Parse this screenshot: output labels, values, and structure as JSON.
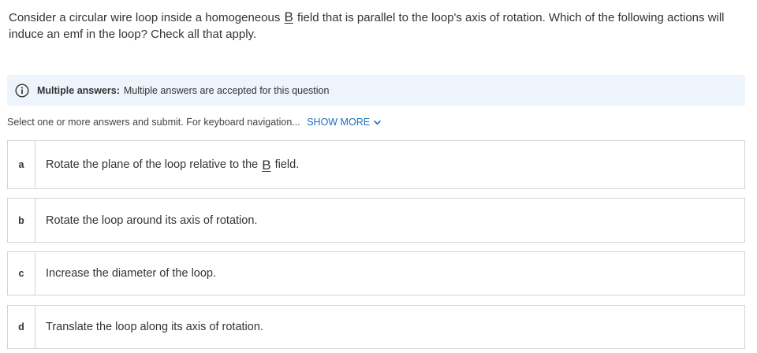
{
  "question": {
    "text_before": "Consider a circular wire loop inside a homogeneous",
    "vector_symbol": "B",
    "text_after": "field that is parallel to the loop's axis of rotation. Which of the following actions will induce an emf in the loop? Check all that apply."
  },
  "info": {
    "icon": "info-circle-icon",
    "label": "Multiple answers:",
    "text": "Multiple answers are accepted for this question"
  },
  "instructions": {
    "text": "Select one or more answers and submit. For keyboard navigation...",
    "show_more": "SHOW MORE"
  },
  "options": [
    {
      "letter": "a",
      "text_before": "Rotate the plane of the loop relative to the",
      "vector_symbol": "B",
      "text_after": "field."
    },
    {
      "letter": "b",
      "text": "Rotate the loop around its axis of rotation."
    },
    {
      "letter": "c",
      "text": "Increase the diameter of the loop."
    },
    {
      "letter": "d",
      "text": "Translate the loop along its axis of rotation."
    }
  ],
  "colors": {
    "link": "#1b6ec2",
    "banner_bg": "#eef4fb",
    "border": "#d4d4d4",
    "text": "#333333"
  }
}
